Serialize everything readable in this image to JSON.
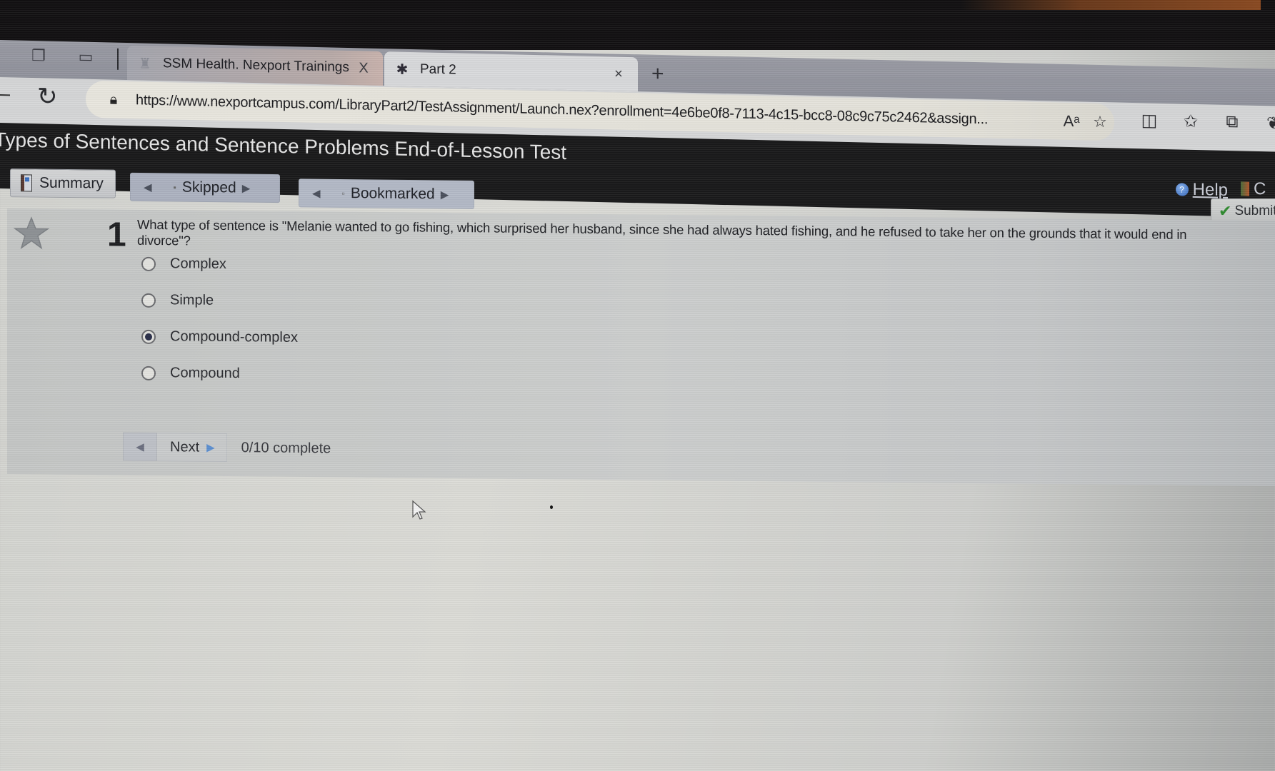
{
  "browser": {
    "tabs": [
      {
        "label": "SSM Health. Nexport Trainings",
        "active": false,
        "close": "X"
      },
      {
        "label": "Part 2",
        "active": true,
        "close": "×"
      }
    ],
    "new_tab": "+",
    "url": "https://www.nexportcampus.com/LibraryPart2/TestAssignment/Launch.nex?enrollment=4e6be0f8-7113-4c15-bcc8-08c9c75c2462&assign...",
    "read_aloud": "Aᵃ",
    "icons": [
      "read-aloud",
      "favorite-star",
      "split-screen",
      "favorites-list",
      "collections",
      "copilot"
    ]
  },
  "page": {
    "title": "Types of Sentences and Sentence Problems End-of-Lesson Test",
    "help_label": "Help",
    "exit_label": "C"
  },
  "nav": {
    "summary_label": "Summary",
    "skipped_label": "Skipped",
    "bookmarked_label": "Bookmarked",
    "submit_label": "Submit"
  },
  "question": {
    "number": "1",
    "text": "What type of sentence is \"Melanie wanted to go fishing, which surprised her husband, since she had always hated fishing, and he refused to take her on the grounds that it would end in divorce\"?",
    "options": [
      {
        "label": "Complex",
        "selected": false
      },
      {
        "label": "Simple",
        "selected": false
      },
      {
        "label": "Compound-complex",
        "selected": true
      },
      {
        "label": "Compound",
        "selected": false
      }
    ],
    "selected_answer": "Compound-complex"
  },
  "pager": {
    "next_label": "Next",
    "progress": "0/10 complete",
    "completed": 0,
    "total": 10
  }
}
